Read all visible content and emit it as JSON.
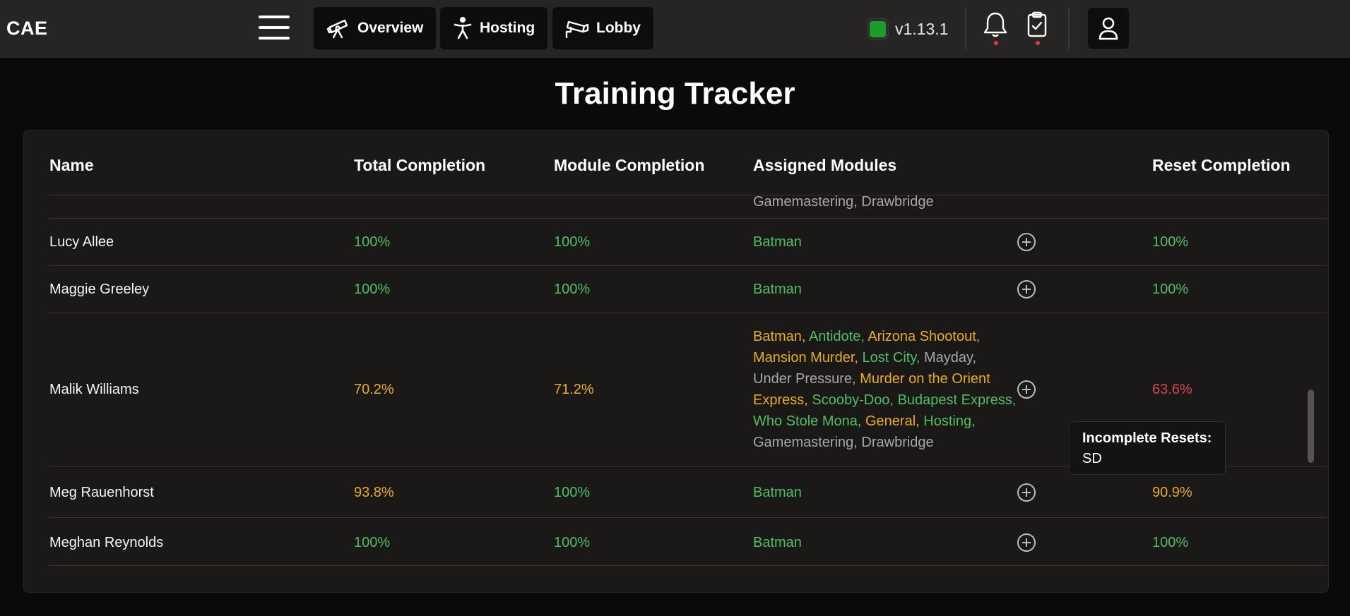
{
  "app": {
    "brand": "CAE",
    "version": "v1.13.1"
  },
  "nav": {
    "overview": "Overview",
    "hosting": "Hosting",
    "lobby": "Lobby"
  },
  "icons": {
    "menu": "hamburger-icon",
    "overview": "telescope-icon",
    "hosting": "person-icon",
    "lobby": "security-camera-icon",
    "status": "status-indicator",
    "notifications": "bell-icon",
    "tasks": "clipboard-check-icon",
    "user": "user-icon",
    "add": "plus-circle-icon"
  },
  "colors": {
    "complete": "#4fbf63",
    "partial": "#e9ac1d",
    "incomplete": "#d9474a",
    "unassigned": "#a9a7a5",
    "status": "#1e9c2a"
  },
  "page": {
    "title": "Training Tracker"
  },
  "table": {
    "headers": {
      "name": "Name",
      "total": "Total Completion",
      "module": "Module Completion",
      "assigned": "Assigned Modules",
      "reset": "Reset Completion"
    },
    "partial_row": {
      "modules": "Gamemastering, Drawbridge"
    },
    "rows": [
      {
        "name": "Lucy Allee",
        "total": "100%",
        "module": "100%",
        "modules_text": "Batman",
        "reset": "100%"
      },
      {
        "name": "Maggie Greeley",
        "total": "100%",
        "module": "100%",
        "modules_text": "Batman",
        "reset": "100%"
      },
      {
        "name": "Malik Williams",
        "total": "70.2%",
        "module": "71.2%",
        "modules": [
          {
            "text": "Batman,",
            "status": "partial"
          },
          {
            "text": "Antidote,",
            "status": "complete"
          },
          {
            "text": "Arizona Shootout,",
            "status": "partial"
          },
          {
            "text": "Mansion Murder,",
            "status": "partial"
          },
          {
            "text": "Lost City,",
            "status": "complete"
          },
          {
            "text": "Mayday,",
            "status": "unassigned"
          },
          {
            "text": "Under Pressure,",
            "status": "unassigned"
          },
          {
            "text": "Murder on the Orient Express,",
            "status": "partial"
          },
          {
            "text": "Scooby-Doo,",
            "status": "complete"
          },
          {
            "text": "Budapest Express,",
            "status": "complete"
          },
          {
            "text": "Who Stole Mona,",
            "status": "complete"
          },
          {
            "text": "General,",
            "status": "partial"
          },
          {
            "text": "Hosting,",
            "status": "complete"
          },
          {
            "text": "Gamemastering,",
            "status": "unassigned"
          },
          {
            "text": "Drawbridge",
            "status": "unassigned"
          }
        ],
        "reset": "63.6%"
      },
      {
        "name": "Meg Rauenhorst",
        "total": "93.8%",
        "module": "100%",
        "modules_text": "Batman",
        "reset": "90.9%"
      },
      {
        "name": "Meghan Reynolds",
        "total": "100%",
        "module": "100%",
        "modules_text": "Batman",
        "reset": "100%"
      }
    ]
  },
  "tooltip": {
    "title": "Incomplete Resets:",
    "body": "SD"
  }
}
